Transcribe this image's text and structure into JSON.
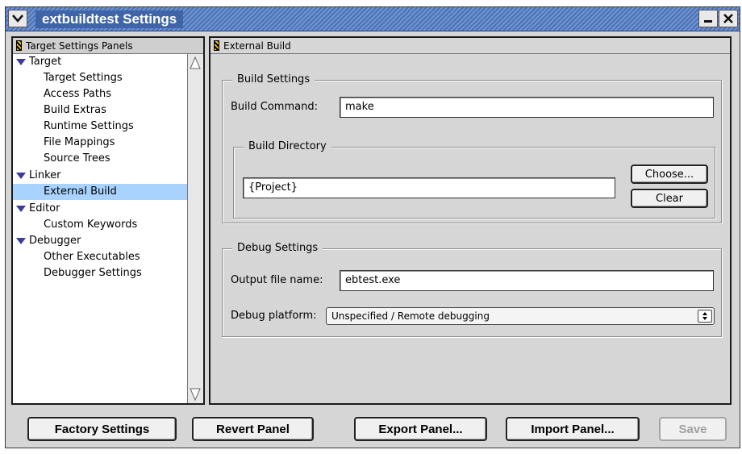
{
  "window": {
    "title": "extbuildtest Settings"
  },
  "left_panel": {
    "header": "Target Settings Panels",
    "groups": [
      {
        "label": "Target",
        "items": [
          "Target Settings",
          "Access Paths",
          "Build Extras",
          "Runtime Settings",
          "File Mappings",
          "Source Trees"
        ]
      },
      {
        "label": "Linker",
        "items": [
          "External Build"
        ]
      },
      {
        "label": "Editor",
        "items": [
          "Custom Keywords"
        ]
      },
      {
        "label": "Debugger",
        "items": [
          "Other Executables",
          "Debugger Settings"
        ]
      }
    ],
    "selected": "External Build"
  },
  "right_panel": {
    "header": "External Build",
    "build_settings": {
      "title": "Build Settings",
      "build_command_label": "Build Command:",
      "build_command_value": "make",
      "build_directory": {
        "title": "Build Directory",
        "value": "{Project}",
        "choose_label": "Choose...",
        "clear_label": "Clear"
      }
    },
    "debug_settings": {
      "title": "Debug Settings",
      "output_label": "Output file name:",
      "output_value": "ebtest.exe",
      "platform_label": "Debug platform:",
      "platform_value": "Unspecified / Remote debugging"
    }
  },
  "footer": {
    "factory_label": "Factory Settings",
    "revert_label": "Revert Panel",
    "export_label": "Export Panel...",
    "import_label": "Import Panel...",
    "save_label": "Save"
  }
}
